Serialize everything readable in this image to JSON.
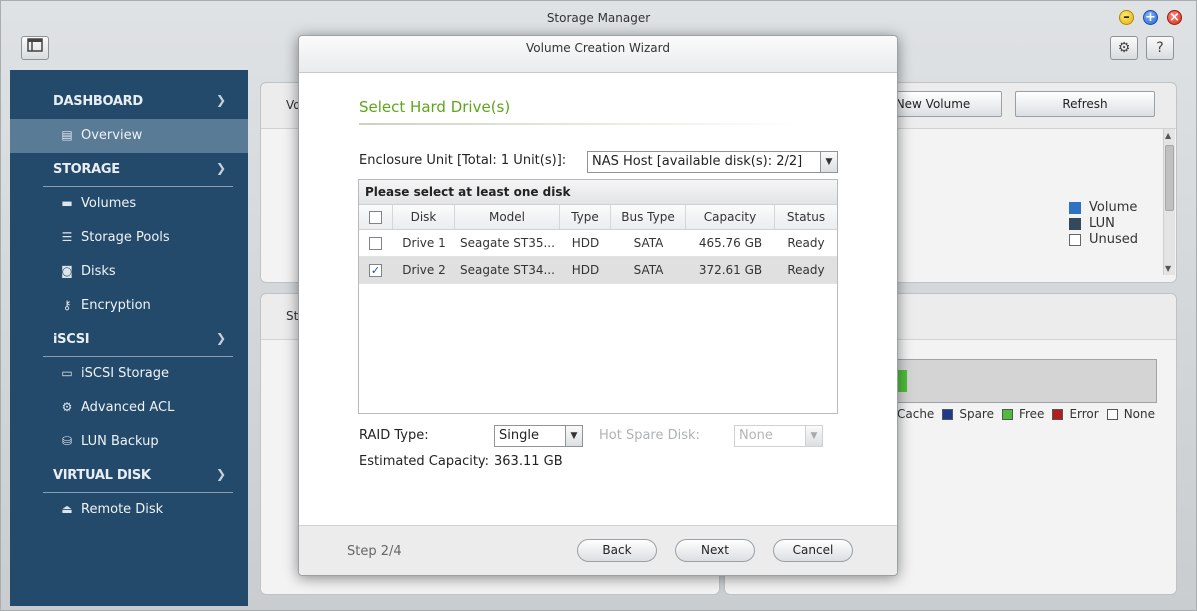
{
  "window": {
    "title": "Storage Manager"
  },
  "sidebar": {
    "sections": [
      {
        "label": "DASHBOARD",
        "items": [
          {
            "label": "Overview",
            "icon": "list-icon",
            "active": true
          }
        ]
      },
      {
        "label": "STORAGE",
        "items": [
          {
            "label": "Volumes",
            "icon": "volume-icon"
          },
          {
            "label": "Storage Pools",
            "icon": "storage-pool-icon"
          },
          {
            "label": "Disks",
            "icon": "disk-icon"
          },
          {
            "label": "Encryption",
            "icon": "key-icon"
          }
        ]
      },
      {
        "label": "iSCSI",
        "items": [
          {
            "label": "iSCSI Storage",
            "icon": "iscsi-storage-icon"
          },
          {
            "label": "Advanced ACL",
            "icon": "gear-icon"
          },
          {
            "label": "LUN Backup",
            "icon": "lun-backup-icon"
          }
        ]
      },
      {
        "label": "VIRTUAL DISK",
        "items": [
          {
            "label": "Remote Disk",
            "icon": "remote-disk-icon"
          }
        ]
      }
    ]
  },
  "background": {
    "panel1_title_fragment": "Vo",
    "panel3_title_fragment": "St",
    "new_volume_label": "New Volume",
    "refresh_label": "Refresh",
    "legend": [
      {
        "label": "Volume",
        "color": "#2f72c4"
      },
      {
        "label": "LUN",
        "color": "#34495c"
      },
      {
        "label": "Unused",
        "color": "#ffffff"
      }
    ],
    "usage_legend": [
      {
        "label": "Cache",
        "color": "#1f9fa5"
      },
      {
        "label": "Spare",
        "color": "#1d3a8f"
      },
      {
        "label": "Free",
        "color": "#4fbd3b"
      },
      {
        "label": "Error",
        "color": "#b21d1d"
      },
      {
        "label": "None",
        "color": "#ffffff"
      }
    ]
  },
  "wizard": {
    "title": "Volume Creation Wizard",
    "step_title": "Select Hard Drive(s)",
    "enclosure_label": "Enclosure Unit [Total: 1 Unit(s)]:",
    "enclosure_value": "NAS Host [available disk(s): 2/2]",
    "grid_caption": "Please select at least one disk",
    "columns": [
      "Disk",
      "Model",
      "Type",
      "Bus Type",
      "Capacity",
      "Status"
    ],
    "rows": [
      {
        "checked": false,
        "disk": "Drive 1",
        "model": "Seagate ST35...",
        "type": "HDD",
        "bus": "SATA",
        "capacity": "465.76 GB",
        "status": "Ready"
      },
      {
        "checked": true,
        "disk": "Drive 2",
        "model": "Seagate ST34...",
        "type": "HDD",
        "bus": "SATA",
        "capacity": "372.61 GB",
        "status": "Ready"
      }
    ],
    "raid_label": "RAID Type:",
    "raid_value": "Single",
    "hot_spare_label": "Hot Spare Disk:",
    "hot_spare_value": "None",
    "capacity_label": "Estimated Capacity:",
    "capacity_value": "363.11 GB",
    "step_indicator": "Step 2/4",
    "back_label": "Back",
    "next_label": "Next",
    "cancel_label": "Cancel"
  }
}
